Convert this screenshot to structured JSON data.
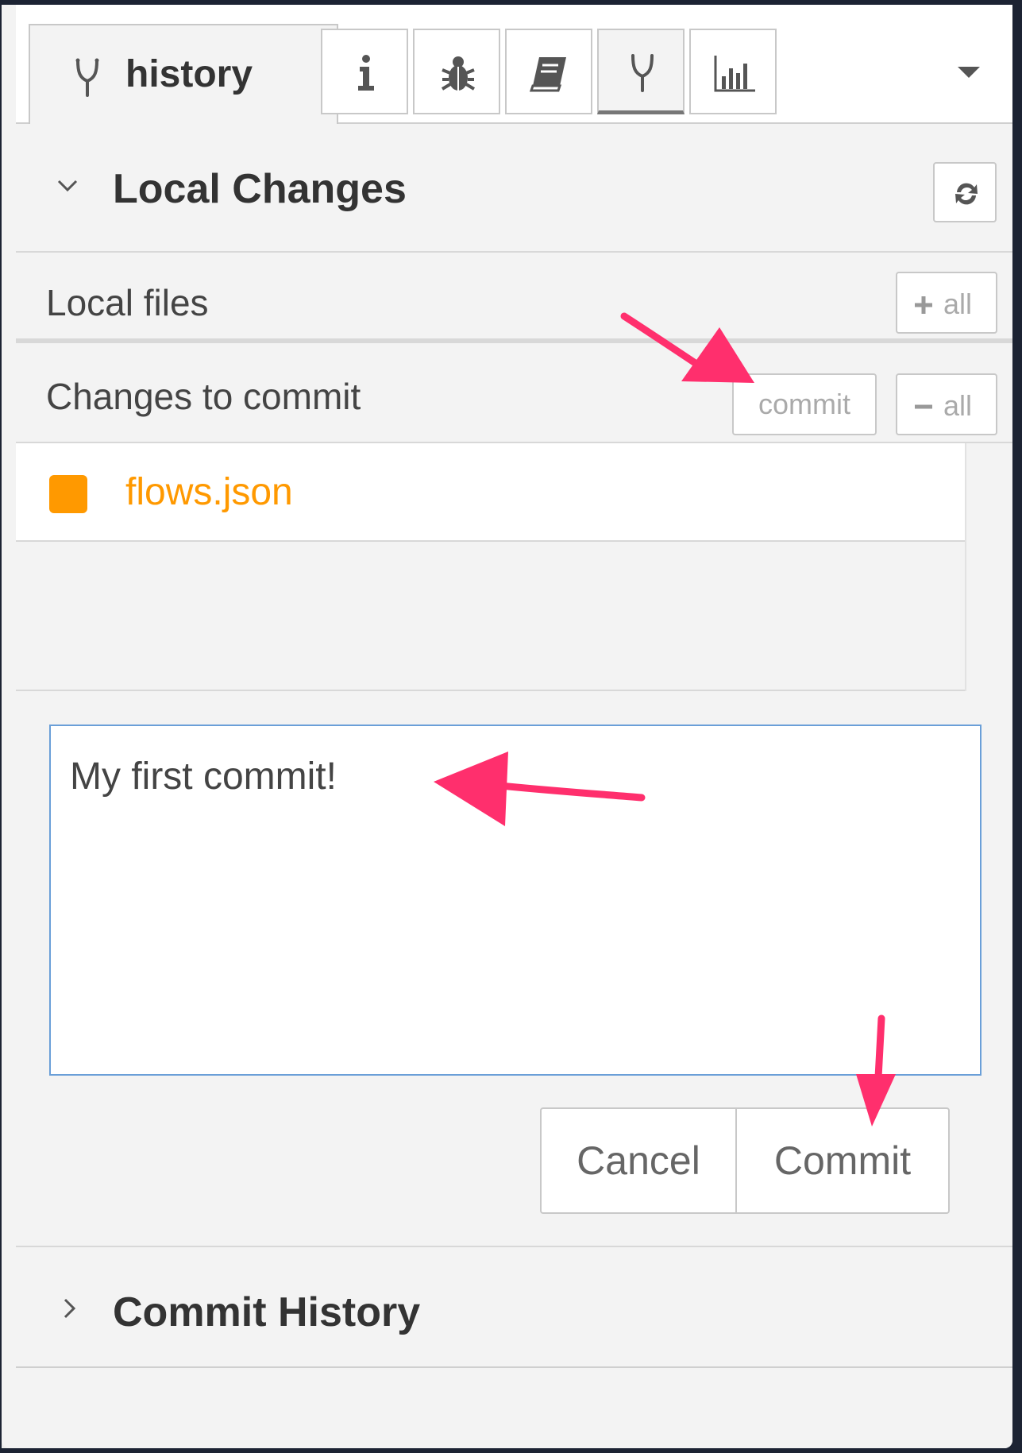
{
  "tabs": {
    "active_label": "history",
    "icons": [
      "branch-icon",
      "info-icon",
      "bug-icon",
      "book-icon",
      "branch-icon",
      "bar-chart-icon",
      "dropdown-caret-icon"
    ]
  },
  "local_changes": {
    "title": "Local Changes",
    "local_files_label": "Local files",
    "add_all_label": "all",
    "changes_label": "Changes to commit",
    "commit_small_label": "commit",
    "remove_all_label": "all",
    "files": [
      {
        "name": "flows.json",
        "status_color": "#ff9900"
      }
    ]
  },
  "commit_form": {
    "message": "My first commit!",
    "cancel_label": "Cancel",
    "commit_label": "Commit"
  },
  "commit_history": {
    "title": "Commit History"
  },
  "colors": {
    "accent_orange": "#ff9900",
    "annotation_arrow": "#ff2f6d",
    "input_focus_border": "#6a9fd8"
  }
}
